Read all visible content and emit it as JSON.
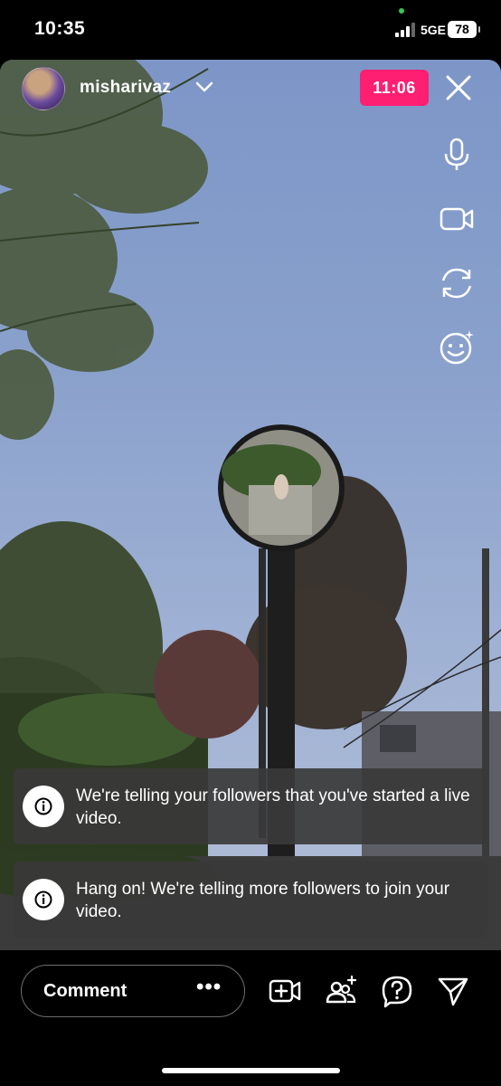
{
  "status_bar": {
    "time": "10:35",
    "network": "5GE",
    "battery": "78"
  },
  "live": {
    "username": "misharivaz",
    "timer": "11:06"
  },
  "side_controls": [
    "microphone-icon",
    "video-camera-icon",
    "flip-camera-icon",
    "effects-face-icon"
  ],
  "notifications": [
    {
      "message": "We're telling your followers that you've started a live video."
    },
    {
      "message": "Hang on! We're telling more followers to join your video."
    }
  ],
  "bottom_bar": {
    "comment_label": "Comment",
    "more_label": "•••",
    "icons": [
      "add-video-icon",
      "invite-guests-icon",
      "question-icon",
      "send-icon"
    ]
  },
  "colors": {
    "timer_background": "#ff1f72",
    "toast_background": "#3a3a3a",
    "sky": "#8aa1cc"
  }
}
